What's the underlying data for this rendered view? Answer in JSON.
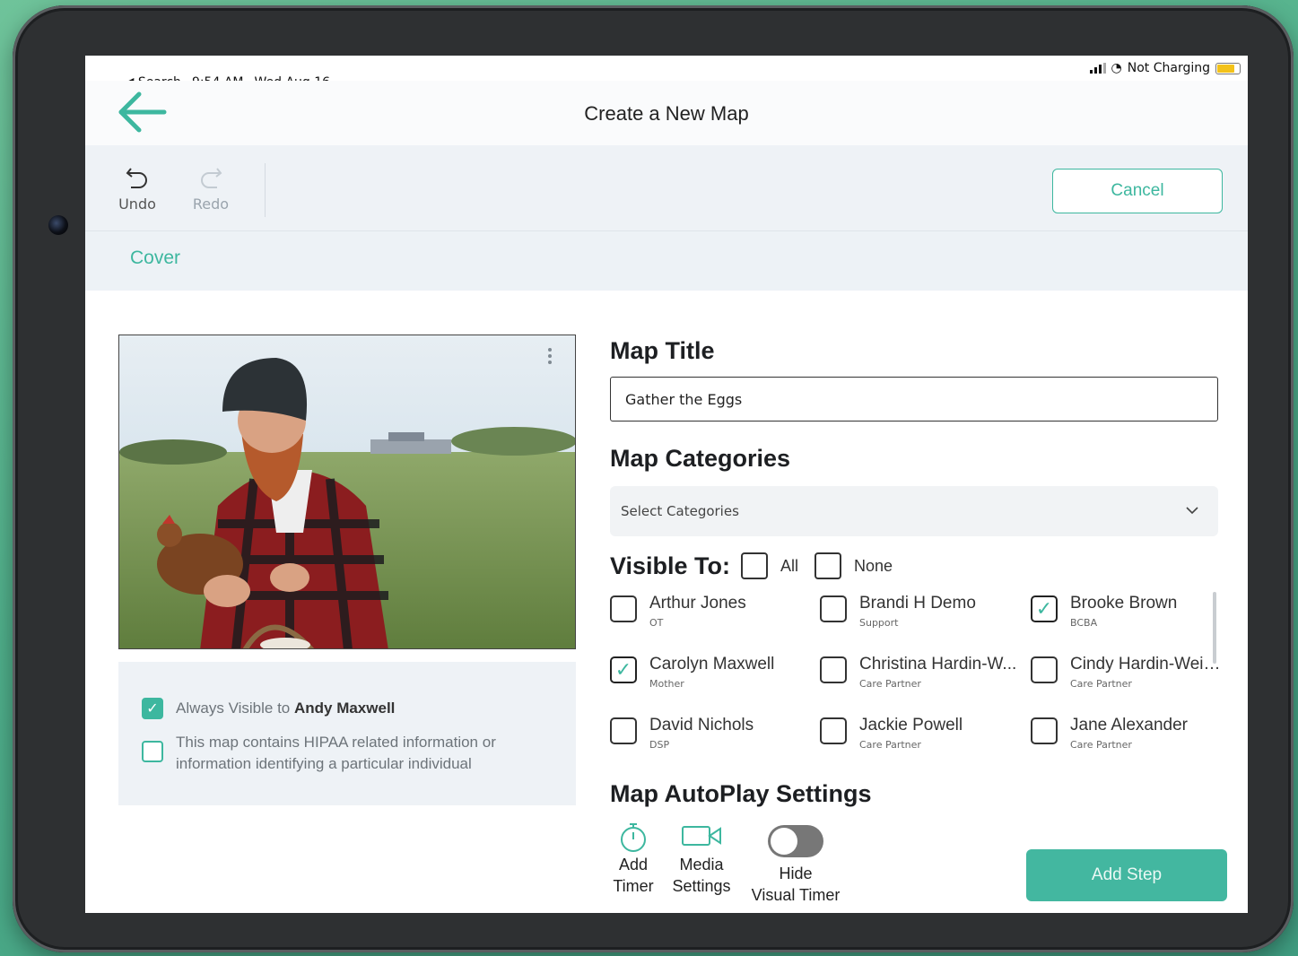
{
  "status_bar": {
    "back_app": "◀ Search",
    "time": "9:54 AM",
    "date": "Wed Aug 16",
    "charging": "Not Charging"
  },
  "header": {
    "title": "Create a New Map",
    "back_icon": "arrow-left-icon"
  },
  "toolbar": {
    "undo_label": "Undo",
    "redo_label": "Redo",
    "cancel_label": "Cancel"
  },
  "section": {
    "tab_label": "Cover"
  },
  "cover_options": {
    "always_visible_prefix": "Always Visible to ",
    "always_visible_name": "Andy Maxwell",
    "always_visible_checked": true,
    "hipaa_text": "This map contains HIPAA related information or information identifying a particular individual",
    "hipaa_checked": false
  },
  "form": {
    "map_title_label": "Map Title",
    "map_title_value": "Gather the Eggs",
    "categories_label": "Map Categories",
    "categories_placeholder": "Select Categories",
    "visible_to_label": "Visible To:",
    "all_label": "All",
    "none_label": "None",
    "people": [
      {
        "name": "Arthur Jones",
        "role": "OT",
        "checked": false
      },
      {
        "name": "Brandi H Demo",
        "role": "Support",
        "checked": false
      },
      {
        "name": "Brooke Brown",
        "role": "BCBA",
        "checked": true
      },
      {
        "name": "Carolyn Maxwell",
        "role": "Mother",
        "checked": true
      },
      {
        "name": "Christina Hardin-W...",
        "role": "Care Partner",
        "checked": false
      },
      {
        "name": "Cindy Hardin-Weis...",
        "role": "Care Partner",
        "checked": false
      },
      {
        "name": "David Nichols",
        "role": "DSP",
        "checked": false
      },
      {
        "name": "Jackie Powell",
        "role": "Care Partner",
        "checked": false
      },
      {
        "name": "Jane Alexander",
        "role": "Care Partner",
        "checked": false
      }
    ],
    "autoplay_label": "Map AutoPlay Settings",
    "add_timer": [
      "Add",
      "Timer"
    ],
    "media_settings": [
      "Media",
      "Settings"
    ],
    "hide_visual_timer": [
      "Hide",
      "Visual Timer"
    ],
    "hide_visual_timer_on": false,
    "add_step_label": "Add Step"
  },
  "colors": {
    "accent": "#3db79f",
    "toolbar_bg": "#eef2f6"
  }
}
